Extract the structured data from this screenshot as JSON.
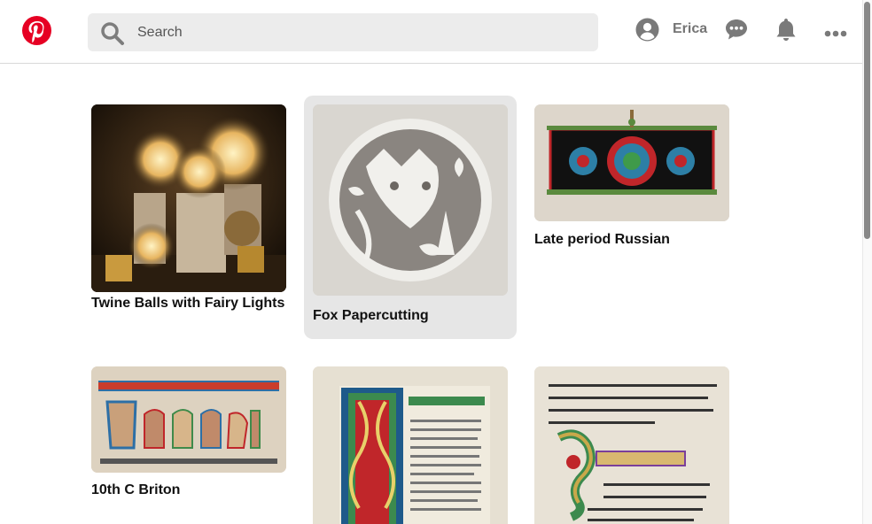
{
  "header": {
    "logo_icon": "pinterest-logo",
    "search": {
      "placeholder": "Search",
      "value": ""
    },
    "user_name": "Erica",
    "icons": [
      "user-avatar-icon",
      "messages-icon",
      "notifications-icon",
      "more-icon"
    ]
  },
  "pins": [
    {
      "title": "Twine Balls with Fairy Lights"
    },
    {
      "title": "Fox Papercutting"
    },
    {
      "title": "Late period Russian"
    },
    {
      "title": "10th C Briton"
    },
    {
      "title": ""
    },
    {
      "title": ""
    }
  ],
  "colors": {
    "brand": "#e60023",
    "hover_card": "#e6e6e6",
    "search_bg": "#ececec"
  }
}
